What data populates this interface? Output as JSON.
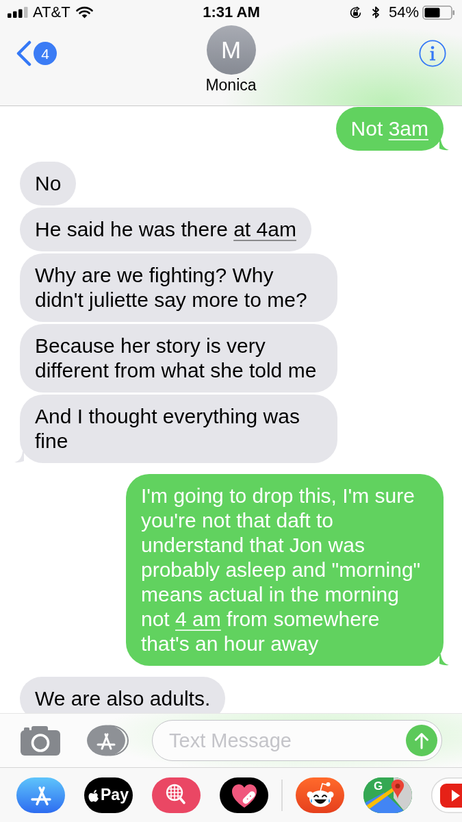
{
  "status_bar": {
    "carrier": "AT&T",
    "time": "1:31 AM",
    "battery": "54%"
  },
  "header": {
    "unread_count": "4",
    "avatar_initial": "M",
    "contact_name": "Monica"
  },
  "messages": [
    {
      "kind": "outgoing",
      "tail": true,
      "parts": [
        {
          "kind": "text",
          "text": "Not "
        },
        {
          "kind": "link",
          "text": "3am"
        }
      ]
    },
    {
      "kind": "incoming",
      "tail": false,
      "parts": [
        {
          "kind": "text",
          "text": "No"
        }
      ]
    },
    {
      "kind": "incoming",
      "tail": false,
      "parts": [
        {
          "kind": "text",
          "text": "He said he was there "
        },
        {
          "kind": "link",
          "text": "at 4am"
        }
      ]
    },
    {
      "kind": "incoming",
      "tail": false,
      "parts": [
        {
          "kind": "text",
          "text": "Why are we fighting? Why didn't juliette say more to me?"
        }
      ]
    },
    {
      "kind": "incoming",
      "tail": false,
      "parts": [
        {
          "kind": "text",
          "text": "Because her story is very different from what she told me"
        }
      ]
    },
    {
      "kind": "incoming",
      "tail": true,
      "parts": [
        {
          "kind": "text",
          "text": "And I thought everything was fine"
        }
      ]
    },
    {
      "kind": "outgoing",
      "tail": true,
      "parts": [
        {
          "kind": "text",
          "text": "I'm going to drop this, I'm sure you're not that daft to understand that Jon was probably asleep and \"morning\" means actual in the morning not "
        },
        {
          "kind": "link",
          "text": "4 am"
        },
        {
          "kind": "text",
          "text": " from somewhere that's an hour away"
        }
      ]
    },
    {
      "kind": "incoming",
      "tail": false,
      "parts": [
        {
          "kind": "text",
          "text": "We are also adults."
        }
      ]
    }
  ],
  "composer": {
    "placeholder": "Text Message"
  },
  "app_drawer": [
    {
      "kind": "apps"
    },
    {
      "kind": "pay",
      "label": "Pay"
    },
    {
      "kind": "globe-search"
    },
    {
      "kind": "heart"
    },
    {
      "kind": "divider"
    },
    {
      "kind": "laughing-face"
    },
    {
      "kind": "maps",
      "label": "G"
    },
    {
      "kind": "video"
    }
  ]
}
